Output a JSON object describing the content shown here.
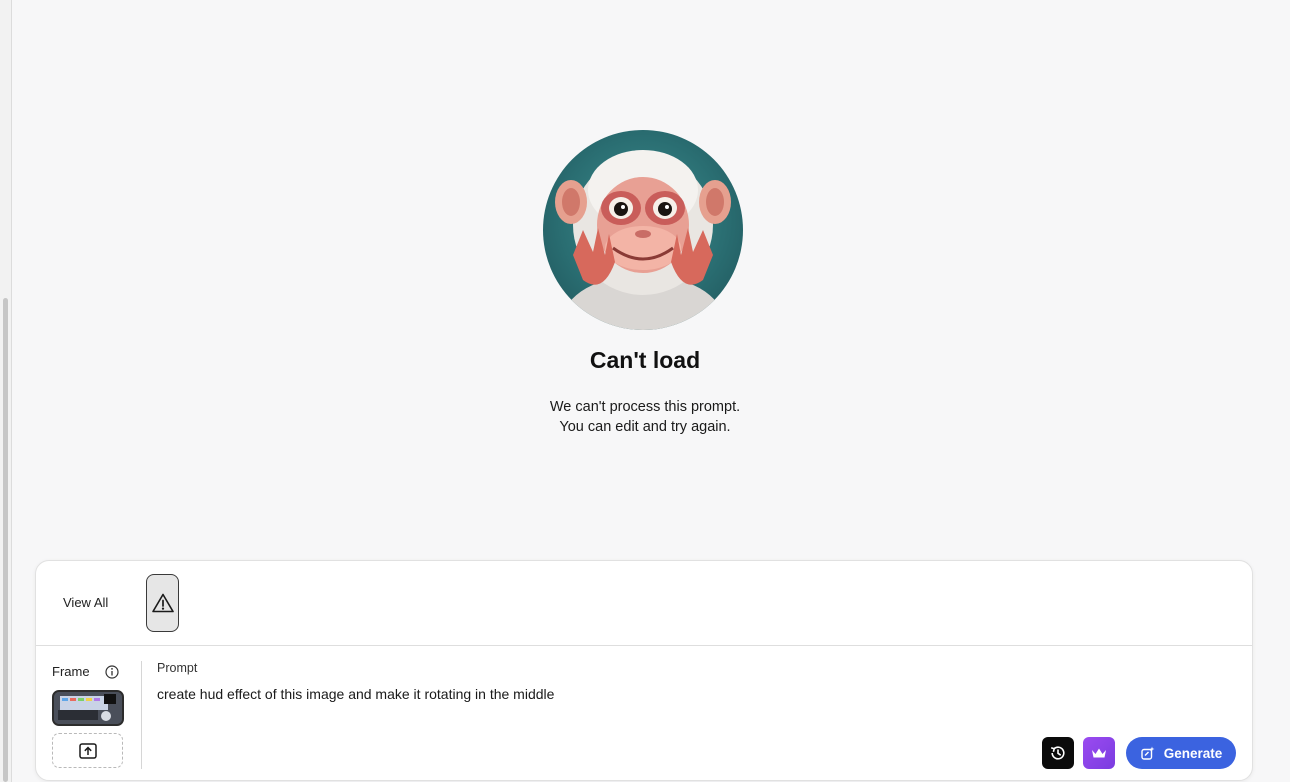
{
  "error": {
    "title": "Can't load",
    "line1": "We can't process this prompt.",
    "line2": "You can edit and try again."
  },
  "gallery": {
    "view_all_label": "View All",
    "thumb_icon": "warning-icon"
  },
  "frame": {
    "label": "Frame",
    "info_icon": "info-icon",
    "upload_icon": "upload-icon"
  },
  "prompt": {
    "label": "Prompt",
    "value": "create hud effect of this image and make it rotating in the middle"
  },
  "actions": {
    "history_icon": "history-icon",
    "premium_icon": "crown-icon",
    "generate_label": "Generate",
    "generate_icon": "generate-icon"
  },
  "colors": {
    "accent": "#3b63e0",
    "premium": "#8a44e8",
    "background": "#f7f7f8"
  }
}
